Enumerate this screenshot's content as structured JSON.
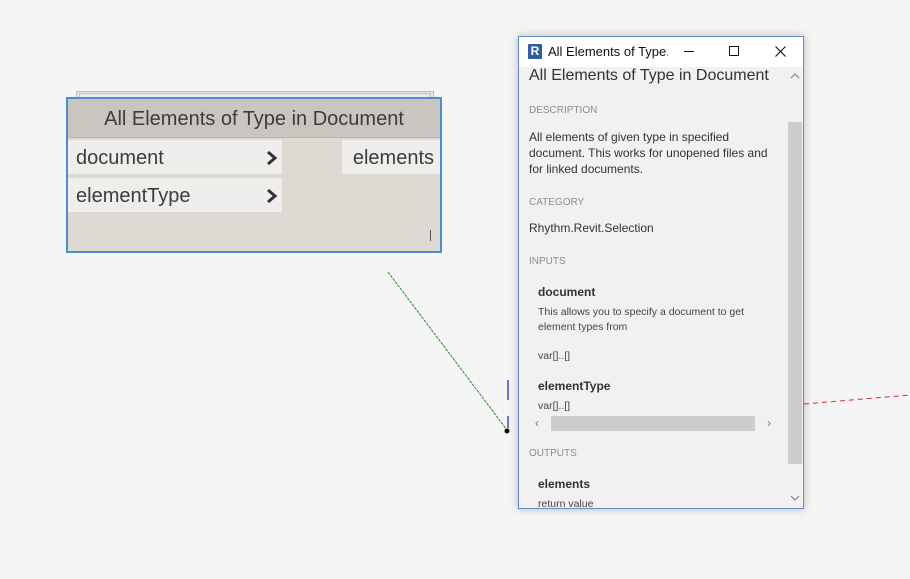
{
  "node": {
    "title": "All Elements of Type in Document",
    "inputs": [
      "document",
      "elementType"
    ],
    "outputs": [
      "elements"
    ]
  },
  "doc_window": {
    "title": "All Elements of Type...",
    "logo": "R",
    "heading": "All Elements of Type in Document",
    "description_label": "DESCRIPTION",
    "description": "All elements of given type in specified document. This works for unopened files and for linked documents.",
    "category_label": "CATEGORY",
    "category": "Rhythm.Revit.Selection",
    "inputs_label": "INPUTS",
    "inputs": [
      {
        "name": "document",
        "description": "This allows you to specify a document to get element types from",
        "type": "var[]..[]"
      },
      {
        "name": "elementType",
        "type": "var[]..[]"
      }
    ],
    "outputs_label": "OUTPUTS",
    "outputs": [
      {
        "name": "elements",
        "description": "return value"
      }
    ]
  },
  "icons": [
    "revit-logo-icon",
    "minimize-icon",
    "maximize-icon",
    "close-icon",
    "chevron-right-icon",
    "scroll-up-icon",
    "scroll-down-icon",
    "scroll-left-icon",
    "scroll-right-icon"
  ],
  "colors": {
    "node_border": "#4a90d0",
    "node_title_bg": "#c9c6bf",
    "wire_green": "#2e8b2e",
    "wire_red": "#d03030",
    "canvas_bg": "#f5f5f5"
  }
}
